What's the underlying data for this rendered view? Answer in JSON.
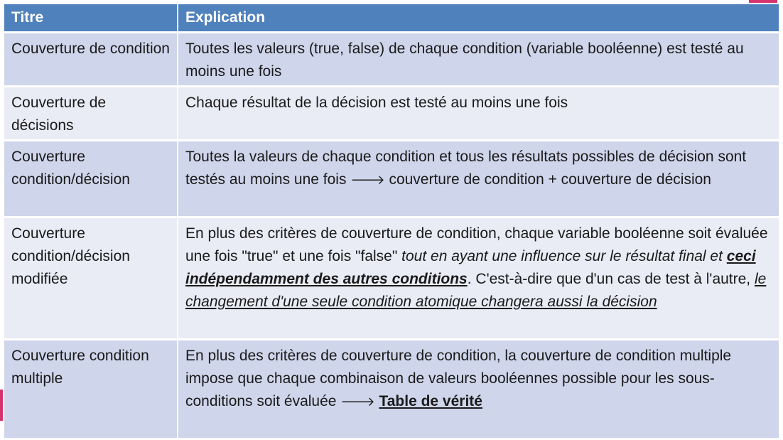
{
  "header": {
    "col_titre": "Titre",
    "col_explication": "Explication"
  },
  "rows": [
    {
      "titre": "Couverture de condition",
      "explication": "Toutes les valeurs (true, false) de chaque condition (variable booléenne) est testé au moins une fois"
    },
    {
      "titre": "Couverture de décisions",
      "explication": "Chaque résultat de la décision est testé au moins une fois"
    },
    {
      "titre": "Couverture condition/décision",
      "explication": "Toutes la valeurs de chaque condition et tous les résultats possibles de décision sont testés au moins une fois",
      "arrow": "🡒",
      "explication_after": "couverture de condition + couverture de décision"
    },
    {
      "titre": "Couverture condition/décision modifiée",
      "explication_part1": "En plus des critères de couverture de condition, chaque variable booléenne soit évaluée une fois \"true\" et une fois  \"false\" ",
      "explication_italic": "tout en ayant une influence sur le résultat final et ",
      "explication_bold_italic_underline": "ceci indépendamment des autres conditions",
      "explication_part2": ". C'est-à-dire que d'un cas de test à l'autre, ",
      "explication_italic_underline": "le changement d'une seule condition atomique changera aussi la décision"
    },
    {
      "titre": "Couverture condition multiple",
      "explication": "En plus des critères de couverture de condition, la couverture de condition multiple impose que chaque combinaison de valeurs booléennes possible pour les sous-conditions soit évaluée",
      "arrow": "🡒",
      "explication_bold_underline": "Table de vérité"
    }
  ],
  "colors": {
    "header_bg": "#4f81bd",
    "row_odd_bg": "#cfd5ea",
    "row_even_bg": "#e9ebf5",
    "accent": "#d6336c"
  }
}
